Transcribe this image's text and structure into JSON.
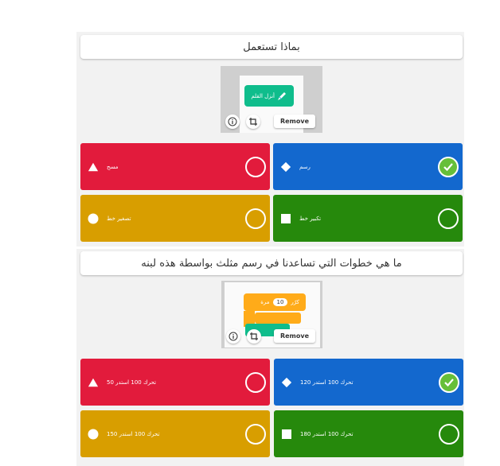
{
  "questions": [
    {
      "title": "بماذا تستعمل",
      "media": {
        "block_label": "أنزل القلم",
        "remove_label": "Remove",
        "info_icon": "info-icon",
        "crop_icon": "crop-icon"
      },
      "answers": [
        {
          "label": "مسح",
          "shape": "triangle",
          "color": "#e21b3c",
          "correct": false
        },
        {
          "label": "رسم",
          "shape": "diamond",
          "color": "#1368ce",
          "correct": true
        },
        {
          "label": "تصغير خط",
          "shape": "circle",
          "color": "#d89e00",
          "correct": false
        },
        {
          "label": "تكبير خط",
          "shape": "square",
          "color": "#26890c",
          "correct": false
        }
      ]
    },
    {
      "title": "ما هي خطوات التي تساعدنا في رسم مثلث بواسطة هذه لبنه",
      "media": {
        "block_prefix": "كرّر",
        "block_value": "10",
        "block_suffix": "مرة",
        "remove_label": "Remove",
        "info_icon": "info-icon",
        "crop_icon": "crop-icon"
      },
      "answers": [
        {
          "label": "تحرك 100 استدر 50",
          "shape": "triangle",
          "color": "#e21b3c",
          "correct": false
        },
        {
          "label": "تحرك 100 استدر 120",
          "shape": "diamond",
          "color": "#1368ce",
          "correct": true
        },
        {
          "label": "تحرك 100 استدر 150",
          "shape": "circle",
          "color": "#d89e00",
          "correct": false
        },
        {
          "label": "تحرك 100 استدر 180",
          "shape": "square",
          "color": "#26890c",
          "correct": false
        }
      ]
    }
  ]
}
